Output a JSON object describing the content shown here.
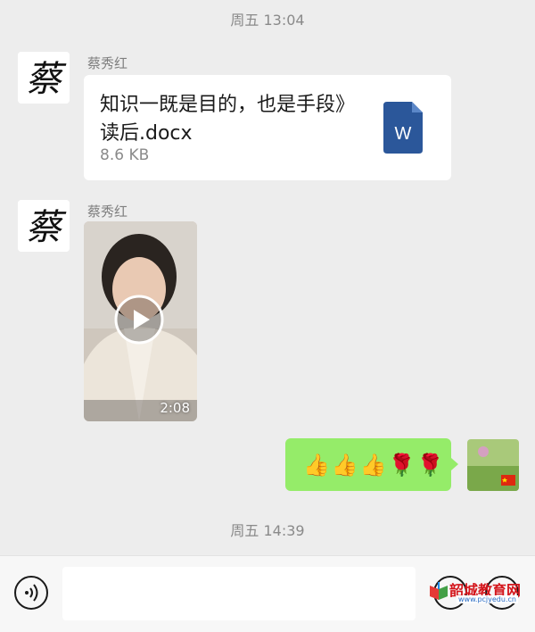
{
  "timestamps": [
    "周五 13:04",
    "周五 14:39"
  ],
  "messages": {
    "file": {
      "sender": "蔡秀红",
      "title": "知识一既是目的，也是手段》读后.docx",
      "size": "8.6 KB",
      "file_type_icon": "word-doc-icon",
      "file_type_letter": "W"
    },
    "video": {
      "sender": "蔡秀红",
      "duration": "2:08"
    },
    "self_emoji": {
      "content": "👍👍👍🌹🌹"
    }
  },
  "avatar": {
    "calligraphy_char": "蔡"
  },
  "input_bar": {
    "placeholder": ""
  },
  "watermark": {
    "text": "韶城教育网",
    "url": "www.pcjyedu.cn"
  },
  "colors": {
    "background": "#ededed",
    "self_bubble": "#95ec69",
    "word_blue": "#2b579a"
  }
}
